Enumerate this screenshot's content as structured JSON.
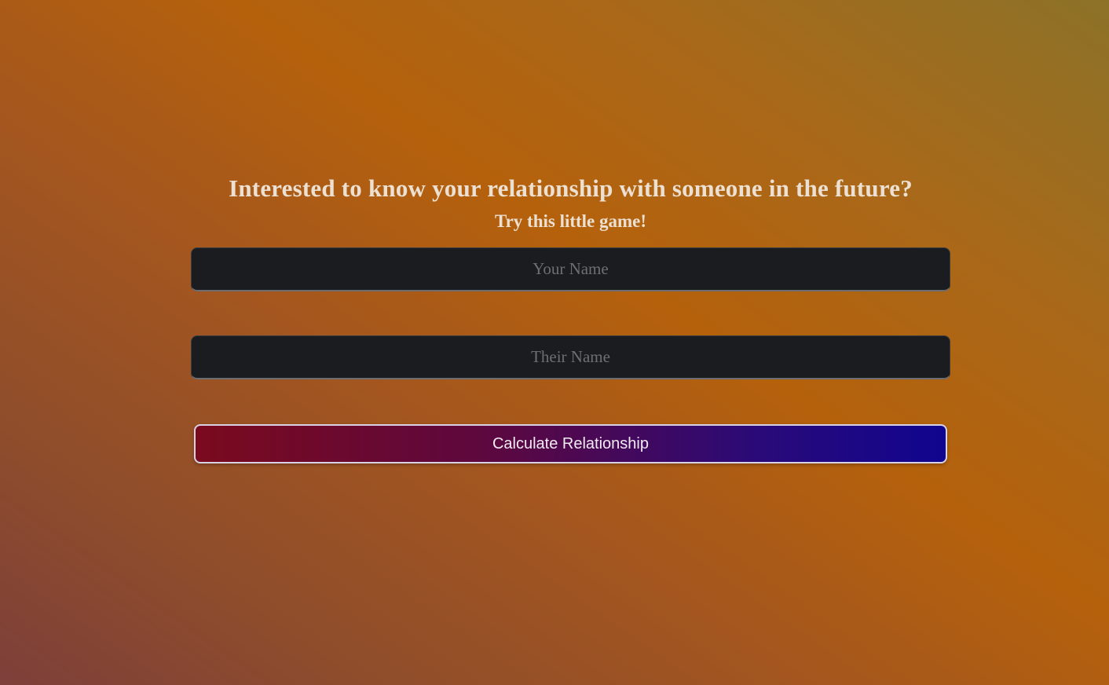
{
  "header": {
    "headline": "Interested to know your relationship with someone in the future?",
    "subheadline": "Try this little game!"
  },
  "form": {
    "your_name": {
      "value": "",
      "placeholder": "Your Name"
    },
    "their_name": {
      "value": "",
      "placeholder": "Their Name"
    },
    "submit_label": "Calculate Relationship"
  },
  "colors": {
    "background_gradient": [
      "#7d3f3a",
      "#b5610c",
      "#8c7228"
    ],
    "input_background": "#1b1c1f",
    "button_gradient": [
      "#7a0a1e",
      "#5c0840",
      "#2a0a78",
      "#10058f"
    ],
    "heading_text": "#ece0d2"
  }
}
